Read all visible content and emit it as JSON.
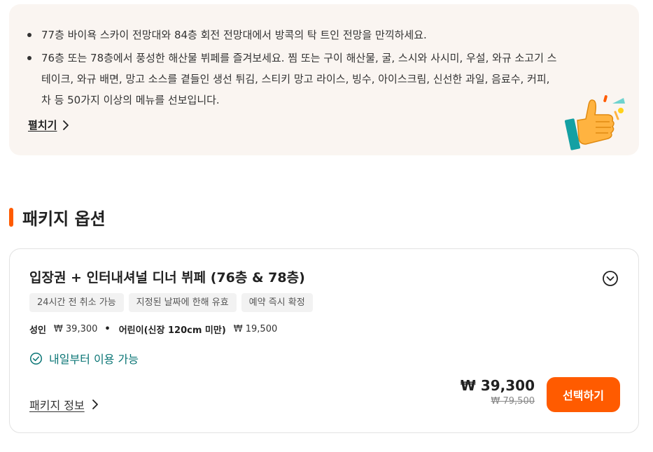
{
  "highlights": {
    "items": [
      "77층 바이욕 스카이 전망대와 84층 회전 전망대에서 방콕의 탁 트인 전망을 만끽하세요.",
      "76층 또는 78층에서 풍성한 해산물 뷔페를 즐겨보세요. 찜 또는 구이 해산물, 굴, 스시와 사시미, 우설, 와규 소고기 스테이크, 와규 배면, 망고 소스를 곁들인 생선 튀김, 스티키 망고 라이스, 빙수, 아이스크림, 신선한 과일, 음료수, 커피, 차 등 50가지 이상의 메뉴를 선보입니다."
    ],
    "expand_label": "펼치기",
    "illustration": "thumbs-up-icon"
  },
  "section": {
    "title": "패키지 옵션"
  },
  "package": {
    "title": "입장권 + 인터내셔널 디너 뷔페 (76층 & 78층)",
    "tags": [
      "24시간 전 취소 가능",
      "지정된 날짜에 한해 유효",
      "예약 즉시 확정"
    ],
    "adult_label": "성인",
    "adult_price": "₩ 39,300",
    "child_label": "어린이(신장 120cm 미만)",
    "child_price": "₩ 19,500",
    "availability": "내일부터 이용 가능",
    "info_link": "패키지 정보",
    "price": "₩ 39,300",
    "original_price": "₩ 79,500",
    "select_label": "선택하기"
  },
  "colors": {
    "accent": "#ff5b00",
    "availability": "#0a7575",
    "highlight_bg": "#faf5f1"
  }
}
